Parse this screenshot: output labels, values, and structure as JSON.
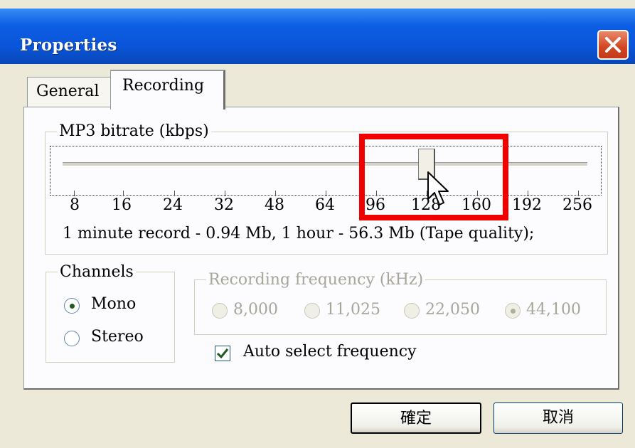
{
  "window": {
    "title": "Properties"
  },
  "tabs": [
    {
      "label": "General"
    },
    {
      "label": "Recording"
    }
  ],
  "bitrate": {
    "group_label": "MP3 bitrate (kbps)",
    "ticks": [
      "8",
      "16",
      "24",
      "32",
      "48",
      "64",
      "96",
      "128",
      "160",
      "192",
      "256"
    ],
    "selected": "128",
    "info": "1 minute record - 0.94 Mb, 1 hour - 56.3 Mb (Tape quality);"
  },
  "channels": {
    "group_label": "Channels",
    "options": [
      {
        "label": "Mono",
        "checked": true
      },
      {
        "label": "Stereo",
        "checked": false
      }
    ]
  },
  "frequency": {
    "group_label": "Recording frequency (kHz)",
    "options": [
      {
        "label": "8,000",
        "checked": false
      },
      {
        "label": "11,025",
        "checked": false
      },
      {
        "label": "22,050",
        "checked": false
      },
      {
        "label": "44,100",
        "checked": true
      }
    ],
    "enabled": false
  },
  "auto_select": {
    "label": "Auto select frequency",
    "checked": true
  },
  "buttons": {
    "ok": "確定",
    "cancel": "取消"
  },
  "colors": {
    "titlebar": "#0a54d8",
    "highlight": "#f20000"
  }
}
